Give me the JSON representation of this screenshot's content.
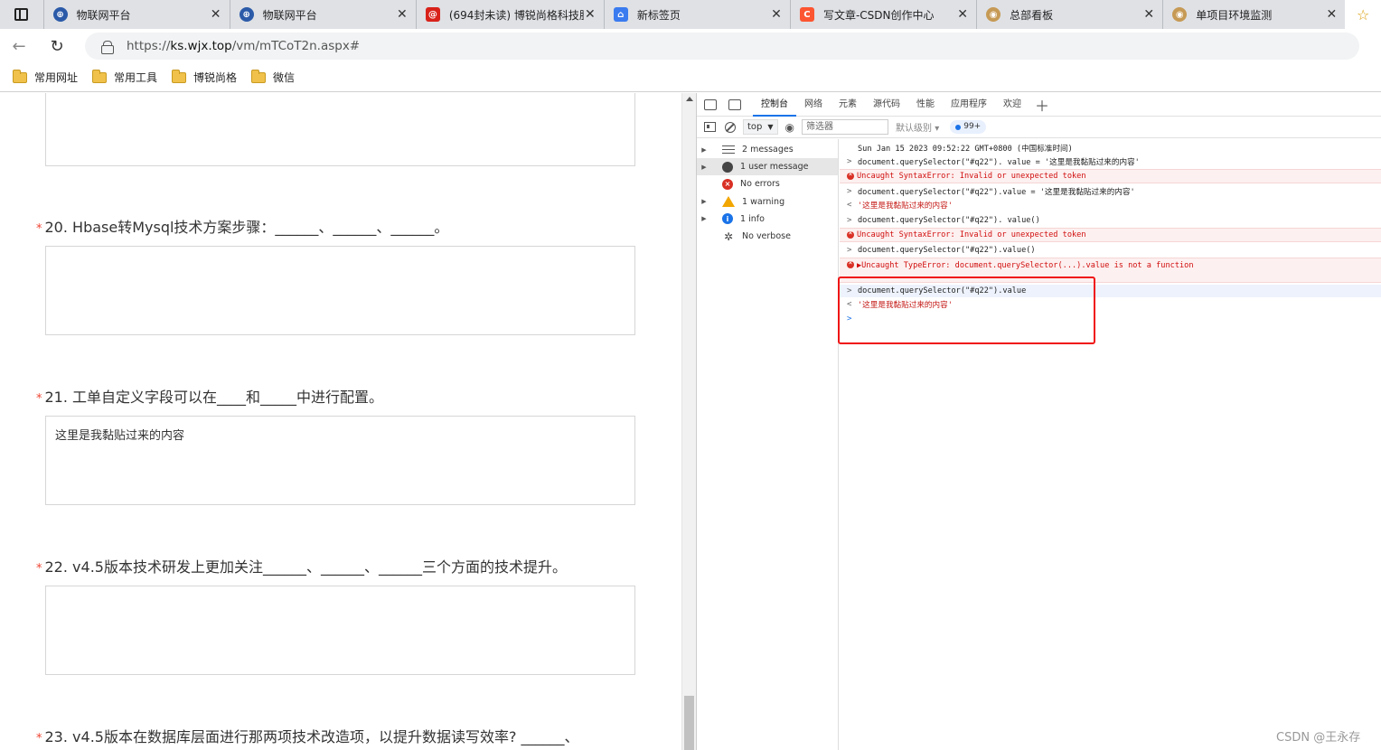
{
  "tabs": [
    {
      "title": "物联网平台",
      "icon": "platform-globe-icon",
      "color": "#2b5aa8"
    },
    {
      "title": "物联网平台",
      "icon": "platform-globe-icon",
      "color": "#2b5aa8"
    },
    {
      "title": "(694封未读) 博锐尚格科技股",
      "icon": "mail-at-icon",
      "color": "#d8221a"
    },
    {
      "title": "新标签页",
      "icon": "new-tab-icon",
      "color": "#3a7bef"
    },
    {
      "title": "写文章-CSDN创作中心",
      "icon": "csdn-c-icon",
      "color": "#fc5531"
    },
    {
      "title": "总部看板",
      "icon": "dashboard-icon",
      "color": "#c69a55"
    },
    {
      "title": "单项目环境监测",
      "icon": "dashboard-icon",
      "color": "#c69a55"
    }
  ],
  "address": {
    "prefix": "https://",
    "host": "ks.wjx.top",
    "path": "/vm/mTCoT2n.aspx#"
  },
  "bookmarks": [
    "常用网址",
    "常用工具",
    "博锐尚格",
    "微信"
  ],
  "questions": [
    {
      "number": "20.",
      "text": "Hbase转Mysql技术方案步骤：______、______、______。",
      "answer": ""
    },
    {
      "number": "21.",
      "text": "工单自定义字段可以在____和_____中进行配置。",
      "answer": "这里是我黏贴过来的内容"
    },
    {
      "number": "22.",
      "text": "v4.5版本技术研发上更加关注______、______、______三个方面的技术提升。",
      "answer": ""
    },
    {
      "number": "23.",
      "text": "v4.5版本在数据库层面进行那两项技术改造项，以提升数据读写效率? ______、",
      "answer": ""
    }
  ],
  "required_mark": "*",
  "devtools": {
    "tabs": [
      "控制台",
      "网络",
      "元素",
      "源代码",
      "性能",
      "应用程序",
      "欢迎"
    ],
    "context": "top",
    "filter_placeholder": "筛选器",
    "levels": "默认级别",
    "issues_count": "99+",
    "sidebar": [
      {
        "label": "2 messages",
        "icon": "list-icon"
      },
      {
        "label": "1 user message",
        "icon": "user-icon"
      },
      {
        "label": "No errors",
        "icon": "error-icon"
      },
      {
        "label": "1 warning",
        "icon": "warning-icon"
      },
      {
        "label": "1 info",
        "icon": "info-icon"
      },
      {
        "label": "No verbose",
        "icon": "bug-icon"
      }
    ],
    "console": [
      {
        "type": "log",
        "prompt": "",
        "text": "Sun Jan 15 2023 09:52:22 GMT+0800 (中国标准时间)"
      },
      {
        "type": "input",
        "prompt": ">",
        "text": "document.querySelector(\"#q22\"). value = '这里是我黏贴过来的内容'"
      },
      {
        "type": "error",
        "prompt": "",
        "text": "Uncaught SyntaxError: Invalid or unexpected token"
      },
      {
        "type": "input",
        "prompt": ">",
        "text": "document.querySelector(\"#q22\").value = '这里是我黏贴过来的内容'"
      },
      {
        "type": "result",
        "prompt": "<",
        "text": "'这里是我黏贴过来的内容'"
      },
      {
        "type": "input",
        "prompt": ">",
        "text": "document.querySelector(\"#q22\"). value()"
      },
      {
        "type": "error",
        "prompt": "",
        "text": "Uncaught SyntaxError: Invalid or unexpected token"
      },
      {
        "type": "input",
        "prompt": ">",
        "text": "document.querySelector(\"#q22\").value()"
      },
      {
        "type": "error",
        "prompt": "",
        "text": "▶Uncaught TypeError: document.querySelector(...).value is not a function"
      },
      {
        "type": "input",
        "prompt": ">",
        "text": "document.querySelector(\"#q22\").value"
      },
      {
        "type": "result",
        "prompt": "<",
        "text": "'这里是我黏贴过来的内容'"
      },
      {
        "type": "prompt",
        "prompt": ">",
        "text": ""
      }
    ]
  },
  "watermark": "CSDN @王永存"
}
